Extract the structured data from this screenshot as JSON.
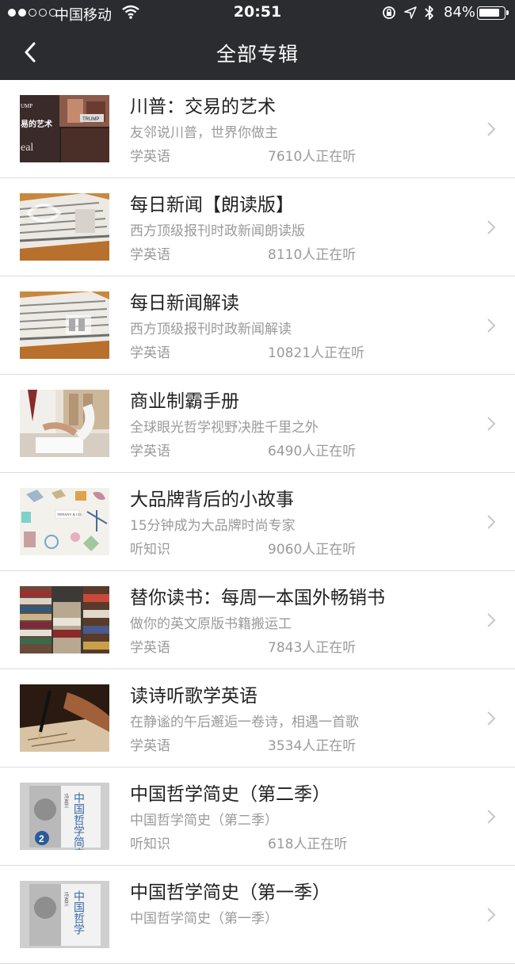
{
  "status_bar": {
    "carrier": "中国移动",
    "time": "20:51",
    "battery": "84%",
    "battery_level": 0.84
  },
  "nav": {
    "title": "全部专辑",
    "back_icon": "chevron-left-icon"
  },
  "albums": [
    {
      "title": "川普：交易的艺术",
      "subtitle": "友邻说川普，世界你做主",
      "category": "学英语",
      "listeners": "7610人正在听"
    },
    {
      "title": "每日新闻【朗读版】",
      "subtitle": "西方顶级报刊时政新闻朗读版",
      "category": "学英语",
      "listeners": "8110人正在听"
    },
    {
      "title": "每日新闻解读",
      "subtitle": "西方顶级报刊时政新闻解读",
      "category": "学英语",
      "listeners": "10821人正在听"
    },
    {
      "title": "商业制霸手册",
      "subtitle": "全球眼光哲学视野决胜千里之外",
      "category": "学英语",
      "listeners": "6490人正在听"
    },
    {
      "title": "大品牌背后的小故事",
      "subtitle": "15分钟成为大品牌时尚专家",
      "category": "听知识",
      "listeners": "9060人正在听"
    },
    {
      "title": "替你读书：每周一本国外畅销书",
      "subtitle": "做你的英文原版书籍搬运工",
      "category": "学英语",
      "listeners": "7843人正在听"
    },
    {
      "title": "读诗听歌学英语",
      "subtitle": "在静谧的午后邂逅一卷诗，相遇一首歌",
      "category": "学英语",
      "listeners": "3534人正在听"
    },
    {
      "title": "中国哲学简史（第二季）",
      "subtitle": "中国哲学简史（第二季）",
      "category": "听知识",
      "listeners": "618人正在听"
    },
    {
      "title": "中国哲学简史（第一季）",
      "subtitle": "中国哲学简史（第一季）",
      "category": "",
      "listeners": ""
    }
  ],
  "thumb_text": {
    "trump": "UMP",
    "trump_2": "易的艺术",
    "trump_3": "TRUMP",
    "trump_4": "eal",
    "tiffany": "TIFFANY & CO.",
    "philo_2_book": "中国哲学简史",
    "philo_2_author": "冯友兰",
    "philo_2_badge": "2",
    "philo_1_book": "中国哲学",
    "philo_1_author": "冯友兰"
  }
}
